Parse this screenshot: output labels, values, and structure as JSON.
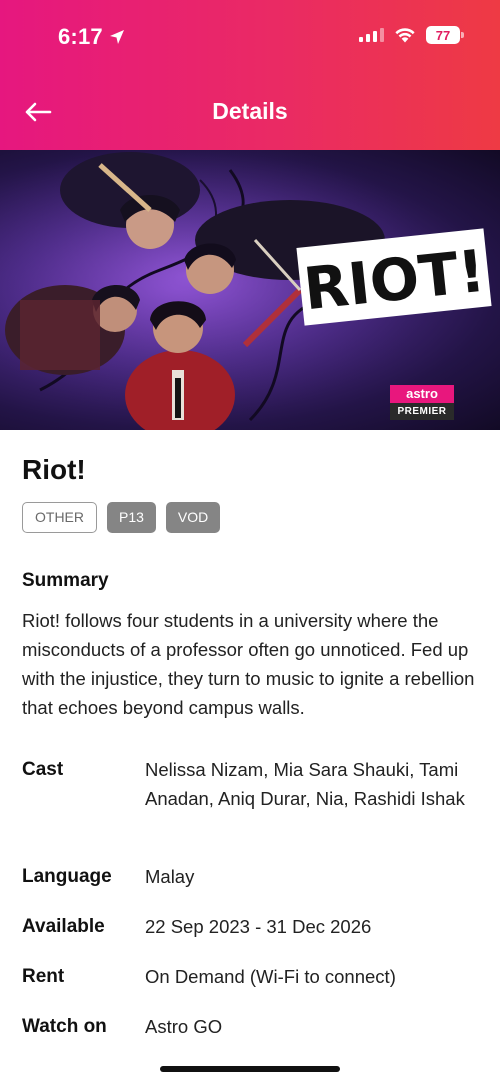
{
  "status_bar": {
    "time": "6:17",
    "battery": "77"
  },
  "nav": {
    "title": "Details",
    "back_icon": "arrow-left-icon"
  },
  "poster": {
    "title_art": "RIOT!",
    "badge_top": "astro",
    "badge_bottom": "PREMIER"
  },
  "details": {
    "title": "Riot!",
    "tags": [
      "OTHER",
      "P13",
      "VOD"
    ],
    "summary_label": "Summary",
    "summary": "Riot! follows four students in a university where the misconducts of a professor often go unnoticed. Fed up with the injustice, they turn to music to ignite a rebellion that echoes beyond campus walls.",
    "rows": [
      {
        "label": "Cast",
        "value": "Nelissa Nizam, Mia Sara Shauki, Tami Anadan, Aniq Durar, Nia, Rashidi Ishak"
      },
      {
        "label": "Language",
        "value": "Malay"
      },
      {
        "label": "Available",
        "value": "22 Sep 2023 - 31 Dec 2026"
      },
      {
        "label": "Rent",
        "value": "On Demand (Wi-Fi to connect)"
      },
      {
        "label": "Watch on",
        "value": "Astro GO"
      }
    ]
  },
  "colors": {
    "header_start": "#e6177f",
    "header_end": "#ee3a44",
    "astro_pink": "#e8177d",
    "tag_filled": "#858585"
  }
}
